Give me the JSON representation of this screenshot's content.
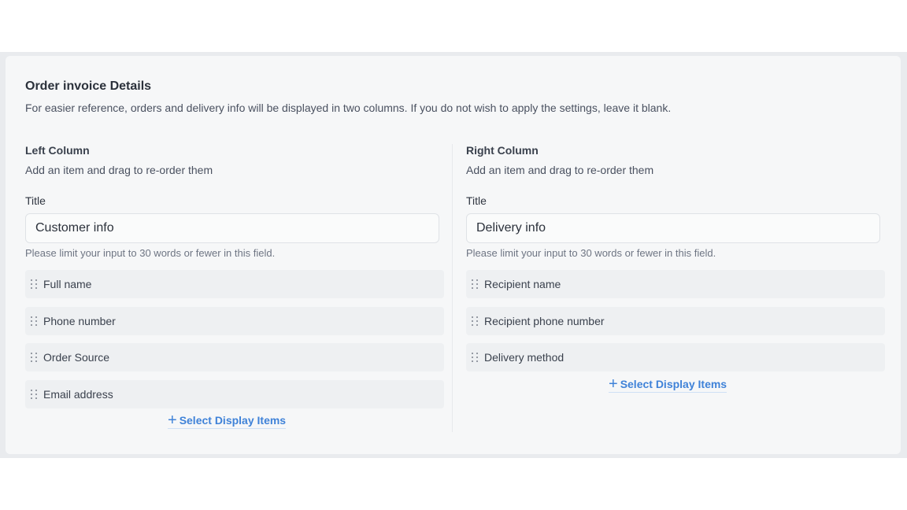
{
  "section": {
    "title": "Order invoice Details",
    "description": "For easier reference, orders and delivery info will be displayed in two columns. If you do not wish to apply the settings, leave it blank."
  },
  "left": {
    "heading": "Left Column",
    "subheading": "Add an item and drag to re-order them",
    "title_label": "Title",
    "title_value": "Customer info",
    "hint": "Please limit your input to 30 words or fewer in this field.",
    "items": [
      {
        "label": "Full name"
      },
      {
        "label": "Phone number"
      },
      {
        "label": "Order Source"
      },
      {
        "label": "Email address"
      }
    ],
    "add_label": "Select Display Items"
  },
  "right": {
    "heading": "Right Column",
    "subheading": "Add an item and drag to re-order them",
    "title_label": "Title",
    "title_value": "Delivery info",
    "hint": "Please limit your input to 30 words or fewer in this field.",
    "items": [
      {
        "label": "Recipient name"
      },
      {
        "label": "Recipient phone number"
      },
      {
        "label": "Delivery method"
      }
    ],
    "add_label": "Select Display Items"
  },
  "icons": {
    "drag_handle": "drag-handle-icon",
    "add": "plus-icon"
  },
  "colors": {
    "accent": "#3f82d8",
    "card_background": "#f6f7f8",
    "item_background": "#eef0f2"
  }
}
